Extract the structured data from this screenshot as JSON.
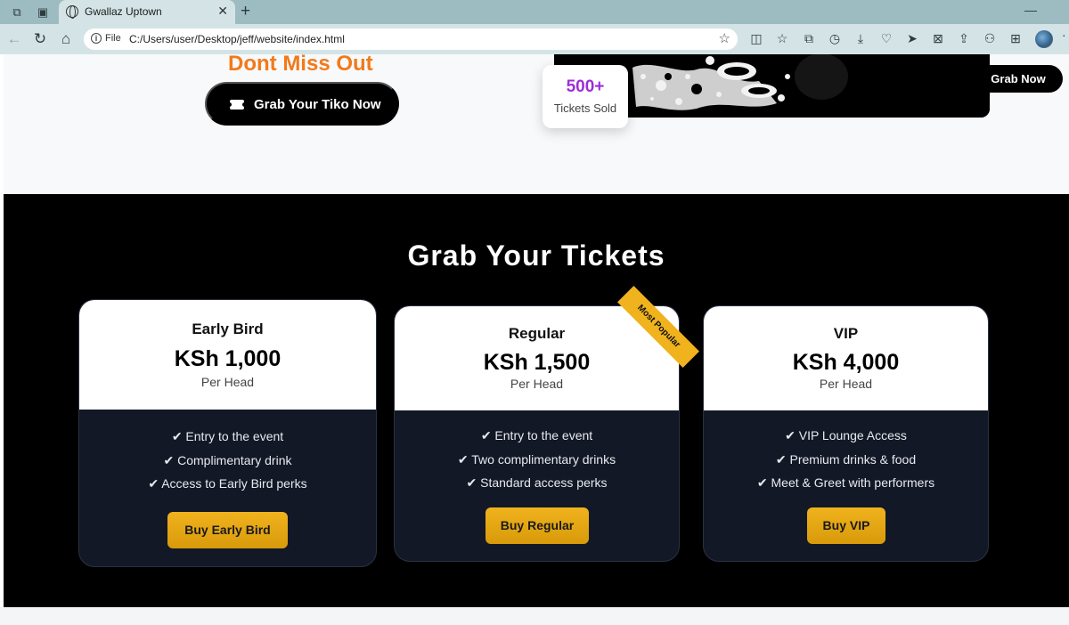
{
  "browser": {
    "tab_title": "Gwallaz Uptown",
    "tab_close": "✕",
    "new_tab": "+",
    "address_scheme": "File",
    "address_url": "C:/Users/user/Desktop/jeff/website/index.html"
  },
  "hero": {
    "heading": "Dont Miss Out",
    "cta_label": "Grab Your Tiko Now",
    "stat_value": "500+",
    "stat_label": "Tickets Sold",
    "nav_cta_label": "Grab Now"
  },
  "tickets": {
    "title": "Grab Your Tickets",
    "badge": "Most Popular",
    "cards": [
      {
        "name": "Early Bird",
        "price": "KSh 1,000",
        "unit": "Per Head",
        "perks": [
          "✔ Entry to the event",
          "✔ Complimentary drink",
          "✔ Access to Early Bird perks"
        ],
        "button": "Buy Early Bird"
      },
      {
        "name": "Regular",
        "price": "KSh 1,500",
        "unit": "Per Head",
        "perks": [
          "✔ Entry to the event",
          "✔ Two complimentary drinks",
          "✔ Standard access perks"
        ],
        "button": "Buy Regular"
      },
      {
        "name": "VIP",
        "price": "KSh 4,000",
        "unit": "Per Head",
        "perks": [
          "✔ VIP Lounge Access",
          "✔ Premium drinks & food",
          "✔ Meet & Greet with performers"
        ],
        "button": "Buy VIP"
      }
    ]
  },
  "colors": {
    "accent_orange": "#f27a1a",
    "stat_purple": "#9b2fd6",
    "button_gold": "#f0b31e",
    "card_dark": "#121826"
  }
}
